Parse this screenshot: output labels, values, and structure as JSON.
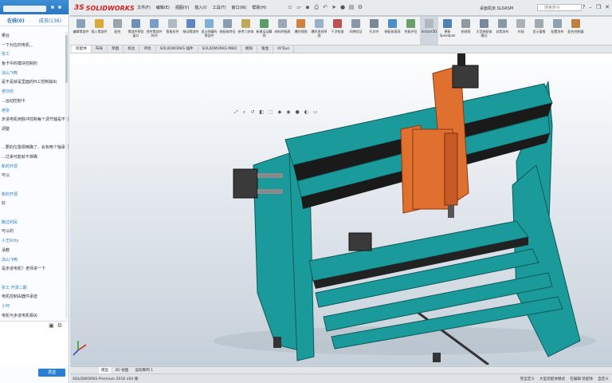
{
  "chat": {
    "tabs": [
      "在线(0)",
      "成员(136)"
    ],
    "messages": [
      {
        "kind": "text",
        "text": "哪台"
      },
      {
        "kind": "text",
        "text": "一下对应的电机..."
      },
      {
        "kind": "name",
        "text": "张工"
      },
      {
        "kind": "text",
        "text": "板卡中的模块控制的"
      },
      {
        "kind": "name",
        "text": "凉山飞鸭"
      },
      {
        "kind": "text",
        "text": "是不是就是里面的PLC控制输出"
      },
      {
        "kind": "name",
        "text": "老刘坊"
      },
      {
        "kind": "text",
        "text": "...运动控制卡"
      },
      {
        "kind": "name",
        "text": "老张"
      },
      {
        "kind": "text",
        "text": "步进电机用脉冲控制每个调节轴是不能"
      },
      {
        "kind": "text",
        "text": "调整"
      },
      {
        "kind": "text",
        "text": ""
      },
      {
        "kind": "text",
        "text": "...要的位置很精确了，会有两个轴承调"
      },
      {
        "kind": "text",
        "text": "...过来可能就不准确"
      },
      {
        "kind": "name",
        "text": "新的开源"
      },
      {
        "kind": "text",
        "text": "可以"
      },
      {
        "kind": "text",
        "text": ""
      },
      {
        "kind": "name",
        "text": "新的开源"
      },
      {
        "kind": "text",
        "text": "好"
      },
      {
        "kind": "text",
        "text": ""
      },
      {
        "kind": "name",
        "text": "路过的民"
      },
      {
        "kind": "text",
        "text": "可以的"
      },
      {
        "kind": "name",
        "text": "小王Kitty"
      },
      {
        "kind": "text",
        "text": "请教"
      },
      {
        "kind": "name",
        "text": "凉山飞鸭"
      },
      {
        "kind": "text",
        "text": "是步进电机？老师讲一下"
      },
      {
        "kind": "text",
        "text": ""
      },
      {
        "kind": "name",
        "text": "张工 开源二期"
      },
      {
        "kind": "text",
        "text": "电机控制由器件承担"
      },
      {
        "kind": "name",
        "text": "小何"
      },
      {
        "kind": "text",
        "text": "电机与步进电机相关"
      }
    ],
    "send_label": "发送"
  },
  "solidworks": {
    "brand": "SOLIDWORKS",
    "brand_prefix": "3S",
    "menu": [
      "文件(F)",
      "编辑(E)",
      "视图(V)",
      "插入(I)",
      "工具(T)",
      "窗口(W)",
      "帮助(H)"
    ],
    "doc_title": "桌面机床.SLDASM",
    "search_placeholder": "搜索命令",
    "ribbon": [
      {
        "label": "编辑零部件",
        "color": "#8aa0b8"
      },
      {
        "label": "插入零部件",
        "color": "#d9a93a"
      },
      {
        "label": "配合",
        "color": "#9aa4ad"
      },
      {
        "label": "零部件预览窗口",
        "color": "#6f8fb8"
      },
      {
        "label": "线性零部件阵列",
        "color": "#7a9cc8"
      },
      {
        "label": "智能扣件",
        "color": "#b0b8c0"
      },
      {
        "label": "移动零部件",
        "color": "#5f86c0"
      },
      {
        "label": "显示隐藏的零部件",
        "color": "#7fb0d8"
      },
      {
        "label": "装配体特征",
        "color": "#8a9db0"
      },
      {
        "label": "参考几何体",
        "color": "#c0a858"
      },
      {
        "label": "新建运动算例",
        "color": "#5c9c6a"
      },
      {
        "label": "材料明细表",
        "color": "#9aa8b8"
      },
      {
        "label": "爆炸视图",
        "color": "#d08040"
      },
      {
        "label": "爆炸直线草图",
        "color": "#9ab0c8"
      },
      {
        "label": "干涉检查",
        "color": "#c05050"
      },
      {
        "label": "间隙验证",
        "color": "#8898a8"
      },
      {
        "label": "孔对齐",
        "color": "#7a8898"
      },
      {
        "label": "装配体直观",
        "color": "#4a90c8"
      },
      {
        "label": "性能评估",
        "color": "#6aa06a"
      },
      {
        "label": "Instant3D",
        "color": "#b0b8c0",
        "selected": true
      },
      {
        "label": "更新Speedpak",
        "color": "#5080b8"
      },
      {
        "label": "拍快照",
        "color": "#9098a0"
      },
      {
        "label": "大型装配体模式",
        "color": "#7888a0"
      },
      {
        "label": "封套发布",
        "color": "#8898a8"
      },
      {
        "label": "外观",
        "color": "#a8b0b8"
      },
      {
        "label": "显示窗格",
        "color": "#a0a8b0"
      },
      {
        "label": "配置发布",
        "color": "#90a0b0"
      },
      {
        "label": "配合控制器",
        "color": "#c08040"
      }
    ],
    "command_tabs": [
      "装配体",
      "布局",
      "草图",
      "标注",
      "评估",
      "SOLIDWORKS 插件",
      "SOLIDWORKS MBD",
      "模拟",
      "钣金",
      "KYTool"
    ],
    "active_command_tab": 0,
    "bottom_tabs": [
      "模型",
      "3D 视图",
      "运动算例 1"
    ],
    "active_bottom_tab": 0,
    "status_left": "SOLIDWORKS Premium 2016 x64 版",
    "status_right": [
      "完全定义",
      "大型装配体模式",
      "在编辑 装配体",
      "自定义"
    ],
    "model": {
      "frame_color": "#1a9a9a",
      "gantry_color": "#e07030",
      "motor_color": "#3a3a3a"
    }
  }
}
